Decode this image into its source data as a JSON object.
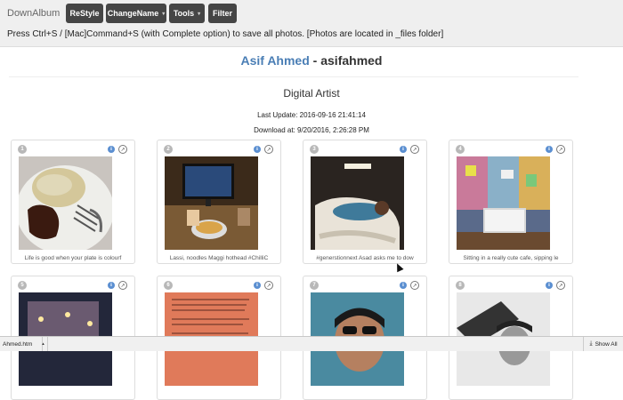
{
  "brand": "DownAlbum",
  "buttons": [
    {
      "label": "ReStyle",
      "caret": false
    },
    {
      "label": "ChangeName",
      "caret": true
    },
    {
      "label": "Tools",
      "caret": true
    },
    {
      "label": "Filter",
      "caret": false
    }
  ],
  "notice": "Press Ctrl+S / [Mac]Command+S (with Complete option) to save all photos. [Photos are located in _files folder]",
  "user": {
    "display_name": "Asif Ahmed",
    "separator": " - ",
    "username": "asifahmed"
  },
  "bio": "Digital Artist",
  "last_update": "Last Update: 2016-09-16 21:41:14",
  "download_at": "Download at: 9/20/2016, 2:26:28 PM",
  "photos": [
    {
      "num": "1",
      "caption": "Life is good when your plate is colourf"
    },
    {
      "num": "2",
      "caption": "Lassi, noodles Maggi hothead #ChilliC"
    },
    {
      "num": "3",
      "caption": "#generstionnext Asad asks me to dow"
    },
    {
      "num": "4",
      "caption": "Sitting in a really cute cafe, sipping le"
    },
    {
      "num": "5",
      "caption": ""
    },
    {
      "num": "6",
      "caption": ""
    },
    {
      "num": "7",
      "caption": ""
    },
    {
      "num": "8",
      "caption": ""
    }
  ],
  "statusbar": {
    "filename": "Ahmed.htm",
    "show_all": "Show All"
  }
}
